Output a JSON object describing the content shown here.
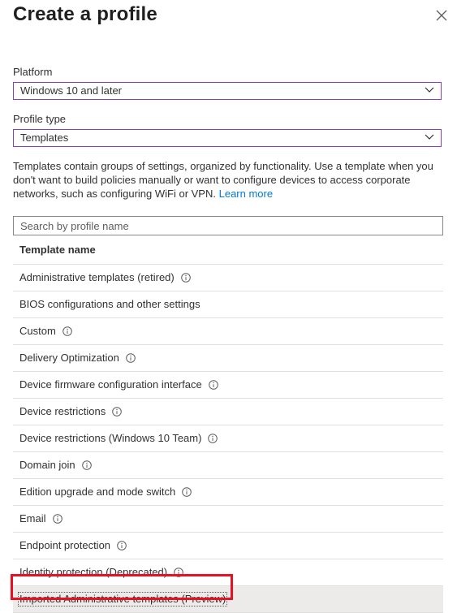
{
  "header": {
    "title": "Create a profile"
  },
  "platform": {
    "label": "Platform",
    "value": "Windows 10 and later"
  },
  "profile_type": {
    "label": "Profile type",
    "value": "Templates"
  },
  "description": {
    "text": "Templates contain groups of settings, organized by functionality. Use a template when you don't want to build policies manually or want to configure devices to access corporate networks, such as configuring WiFi or VPN.",
    "link": "Learn more"
  },
  "search": {
    "placeholder": "Search by profile name"
  },
  "table": {
    "header": "Template name",
    "rows": [
      {
        "label": "Administrative templates (retired)",
        "info": true
      },
      {
        "label": "BIOS configurations and other settings",
        "info": false
      },
      {
        "label": "Custom",
        "info": true
      },
      {
        "label": "Delivery Optimization",
        "info": true
      },
      {
        "label": "Device firmware configuration interface",
        "info": true
      },
      {
        "label": "Device restrictions",
        "info": true
      },
      {
        "label": "Device restrictions (Windows 10 Team)",
        "info": true
      },
      {
        "label": "Domain join",
        "info": true
      },
      {
        "label": "Edition upgrade and mode switch",
        "info": true
      },
      {
        "label": "Email",
        "info": true
      },
      {
        "label": "Endpoint protection",
        "info": true
      },
      {
        "label": "Identity protection (Deprecated)",
        "info": true
      },
      {
        "label": "Imported Administrative templates (Preview)",
        "info": false,
        "selected": true
      }
    ]
  },
  "colors": {
    "accent": "#8a3fbf",
    "link": "#0078d4",
    "highlight": "#e81123"
  },
  "icons": {
    "close": "close-icon",
    "chevron": "chevron-down-icon",
    "info": "info-icon"
  }
}
